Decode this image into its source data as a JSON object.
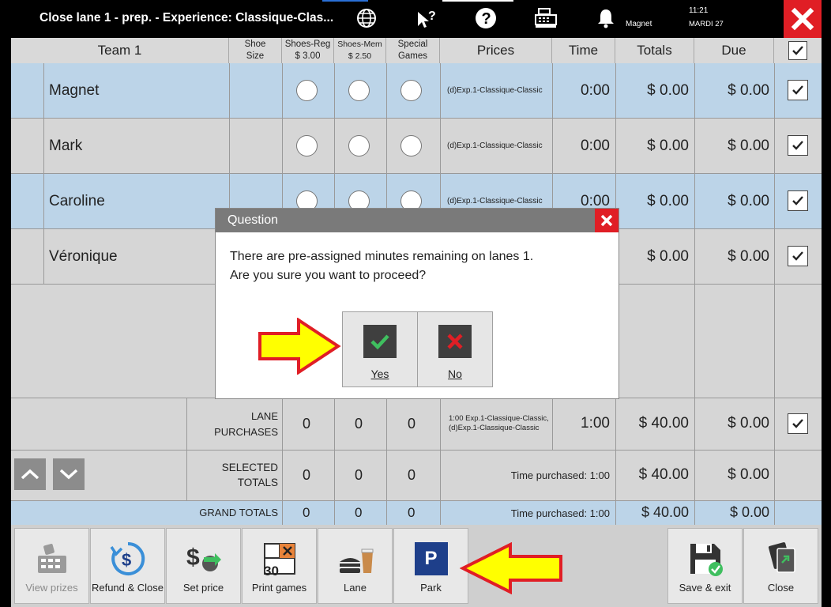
{
  "window": {
    "title": "Close lane 1 - prep. - Experience: Classique-Clas...",
    "user": "Magnet",
    "time": "11:21",
    "date": "MARDI 27"
  },
  "icons": {
    "globe": "globe-icon",
    "help_cursor": "help-cursor-icon",
    "question": "question-icon",
    "cash_register": "cash-register-icon",
    "bell": "bell-icon",
    "close": "close-icon"
  },
  "colors": {
    "red": "#e01e25",
    "row_blue": "#bcd4e8",
    "row_gray": "#d6d6d6",
    "park_blue": "#1e3f8a",
    "arrow_yellow": "#ffff00",
    "arrow_red": "#e01e25",
    "check_green": "#3fbf5f"
  },
  "table": {
    "headers": {
      "team": "Team 1",
      "shoe_size_1": "Shoe",
      "shoe_size_2": "Size",
      "shoes_reg_1": "Shoes-Reg",
      "shoes_reg_2": "$ 3.00",
      "shoes_mem_1": "Shoes-Mem",
      "shoes_mem_2": "$ 2.50",
      "special_1": "Special",
      "special_2": "Games",
      "prices": "Prices",
      "time": "Time",
      "totals": "Totals",
      "due": "Due"
    },
    "rows": [
      {
        "name": "Magnet",
        "price": "(d)Exp.1-Classique-Classic",
        "time": "0:00",
        "total": "$ 0.00",
        "due": "$ 0.00",
        "checked": true
      },
      {
        "name": "Mark",
        "price": "(d)Exp.1-Classique-Classic",
        "time": "0:00",
        "total": "$ 0.00",
        "due": "$ 0.00",
        "checked": true
      },
      {
        "name": "Caroline",
        "price": "(d)Exp.1-Classique-Classic",
        "time": "0:00",
        "total": "$ 0.00",
        "due": "$ 0.00",
        "checked": true
      },
      {
        "name": "Véronique",
        "price": "",
        "time": "",
        "total": "$ 0.00",
        "due": "$ 0.00",
        "checked": true
      }
    ],
    "lane_purchases": {
      "label1": "LANE",
      "label2": "PURCHASES",
      "reg": "0",
      "mem": "0",
      "special": "0",
      "price1": "1:00 Exp.1-Classique-Classic,",
      "price2": "(d)Exp.1-Classique-Classic",
      "time": "1:00",
      "total": "$ 40.00",
      "due": "$ 0.00"
    },
    "selected_totals": {
      "label1": "SELECTED",
      "label2": "TOTALS",
      "reg": "0",
      "mem": "0",
      "special": "0",
      "time_purchased": "Time purchased: 1:00",
      "total": "$ 40.00",
      "due": "$ 0.00"
    },
    "grand_totals": {
      "label": "GRAND TOTALS",
      "reg": "0",
      "mem": "0",
      "special": "0",
      "time_purchased": "Time purchased: 1:00",
      "total": "$ 40.00",
      "due": "$ 0.00"
    }
  },
  "dialog": {
    "title": "Question",
    "message_line1": "There are pre-assigned minutes remaining on lanes  1.",
    "message_line2": "Are you sure you want to proceed?",
    "yes_label": "Yes",
    "no_label": "No"
  },
  "toolbar": {
    "view_prizes": "View prizes",
    "refund_close": "Refund & Close",
    "set_price": "Set price",
    "print_games": "Print games",
    "print_games_icon_text": "30",
    "lane": "Lane",
    "park": "Park",
    "park_icon_letter": "P",
    "save_exit": "Save & exit",
    "close": "Close"
  }
}
